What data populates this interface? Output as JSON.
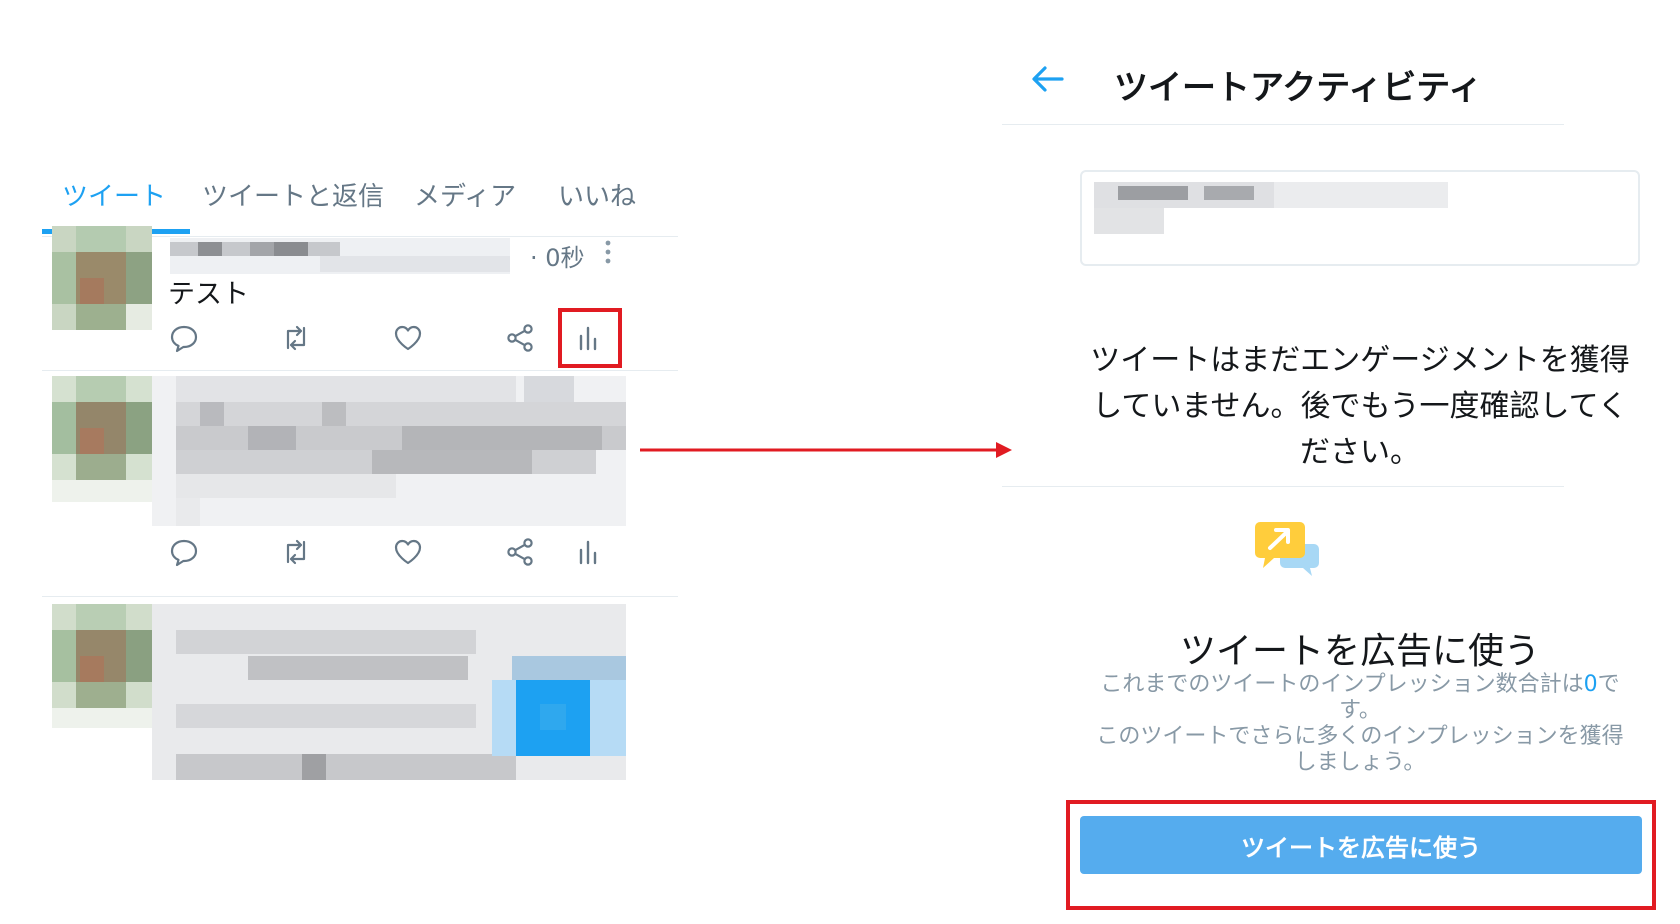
{
  "profile_tabs": {
    "items": [
      {
        "label": "ツイート",
        "active": true
      },
      {
        "label": "ツイートと返信",
        "active": false
      },
      {
        "label": "メディア",
        "active": false
      },
      {
        "label": "いいね",
        "active": false
      }
    ]
  },
  "tweets": [
    {
      "time": "· 0秒",
      "text": "テスト"
    }
  ],
  "activity": {
    "title": "ツイートアクティビティ",
    "empty_line1": "ツイートはまだエンゲージメントを獲得",
    "empty_line2": "していません。後でもう一度確認してく",
    "empty_line3": "ださい。",
    "promo_title": "ツイートを広告に使う",
    "promo_desc_a": "これまでのツイートのインプレッション数合計は",
    "promo_desc_num": "0",
    "promo_desc_b": "で",
    "promo_desc_c": "す。",
    "promo_desc_d": "このツイートでさらに多くのインプレッションを獲得",
    "promo_desc_e": "しましょう。",
    "promo_button": "ツイートを広告に使う"
  },
  "colors": {
    "accent": "#1da1f2",
    "highlight": "#e11b22",
    "button": "#55acee"
  },
  "icons": [
    "reply-icon",
    "retweet-icon",
    "like-icon",
    "share-icon",
    "analytics-icon",
    "back-arrow-icon",
    "more-icon",
    "promote-icon"
  ]
}
